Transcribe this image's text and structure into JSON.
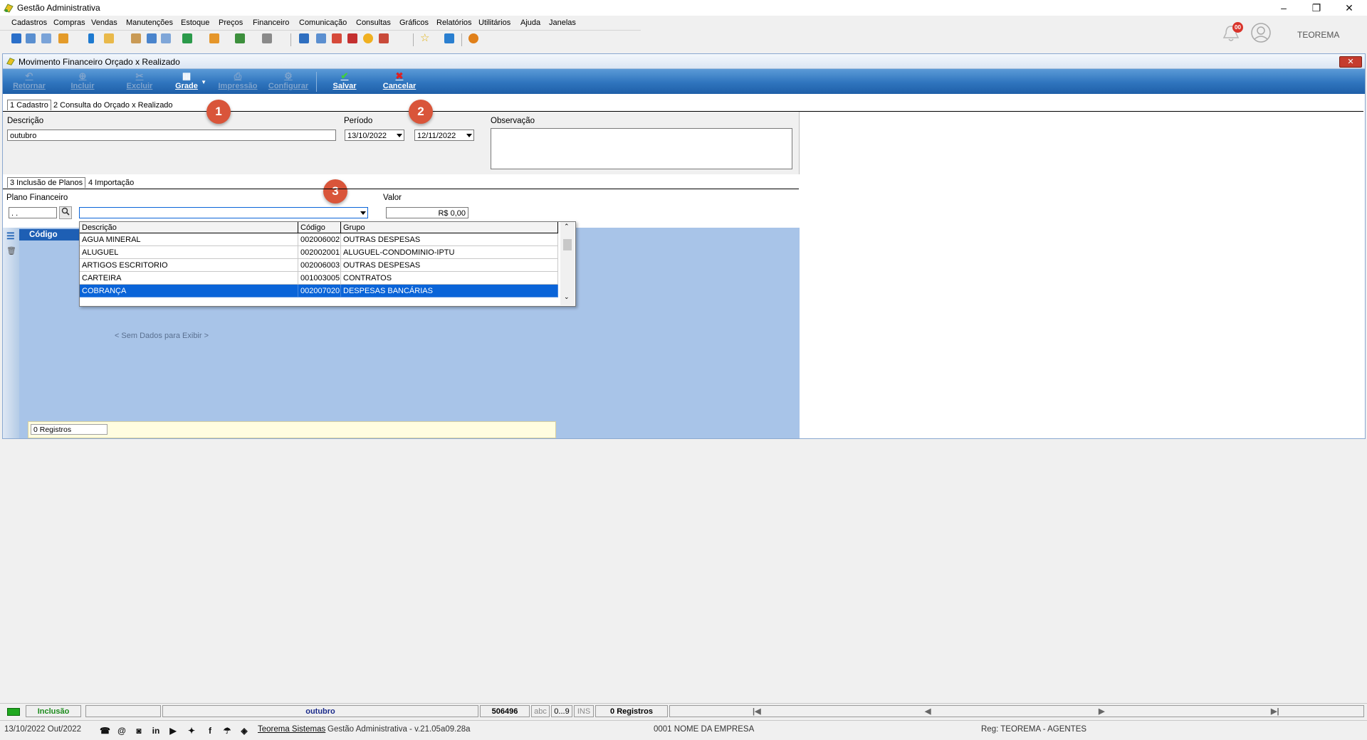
{
  "window": {
    "title": "Gestão Administrativa",
    "controls": {
      "minimize": "–",
      "restore": "❐",
      "close": "✕"
    }
  },
  "menu": [
    "Cadastros",
    "Compras",
    "Vendas",
    "Manutenções",
    "Estoque",
    "Preços",
    "Financeiro",
    "Comunicação",
    "Consultas",
    "Gráficos",
    "Relatórios",
    "Utilitários",
    "Ajuda",
    "Janelas"
  ],
  "header_right": {
    "notifications_count": "00",
    "user_name": "TEOREMA"
  },
  "child_window": {
    "title": "Movimento Financeiro Orçado x Realizado",
    "close_label": "✕"
  },
  "ribbon": {
    "buttons": [
      {
        "label": "Retornar",
        "icon": "↶",
        "enabled": false
      },
      {
        "label": "Incluir",
        "icon": "⊕",
        "enabled": false
      },
      {
        "label": "Excluir",
        "icon": "✂",
        "enabled": false
      },
      {
        "label": "Grade",
        "icon": "▦",
        "enabled": true
      },
      {
        "label": "Impressão",
        "icon": "⎙",
        "enabled": false
      },
      {
        "label": "Configurar",
        "icon": "⚙",
        "enabled": false
      },
      {
        "label": "Salvar",
        "icon": "✔",
        "enabled": true
      },
      {
        "label": "Cancelar",
        "icon": "✖",
        "enabled": true
      }
    ]
  },
  "tabs_main": [
    "1 Cadastro",
    "2 Consulta do Orçado x Realizado"
  ],
  "form": {
    "descricao_label": "Descrição",
    "descricao_value": "outubro",
    "periodo_label": "Período",
    "periodo_inicio": "13/10/2022",
    "periodo_fim": "12/11/2022",
    "observacao_label": "Observação",
    "observacao_value": ""
  },
  "badges": [
    "1",
    "2",
    "3"
  ],
  "tabs_sub": [
    "3 Inclusão de Planos",
    "4 Importação"
  ],
  "plano": {
    "label": "Plano Financeiro",
    "code_value": " .  . ",
    "combo_value": "",
    "valor_label": "Valor",
    "valor_value": "R$ 0,00"
  },
  "dropdown": {
    "headers": [
      "Descrição",
      "Código",
      "Grupo"
    ],
    "rows": [
      {
        "descricao": "AGUA MINERAL",
        "codigo": "002006002",
        "grupo": "OUTRAS DESPESAS"
      },
      {
        "descricao": "ALUGUEL",
        "codigo": "002002001",
        "grupo": "ALUGUEL-CONDOMINIO-IPTU"
      },
      {
        "descricao": "ARTIGOS ESCRITORIO",
        "codigo": "002006003",
        "grupo": "OUTRAS DESPESAS"
      },
      {
        "descricao": "CARTEIRA",
        "codigo": "001003005",
        "grupo": "CONTRATOS"
      },
      {
        "descricao": "COBRANÇA",
        "codigo": "002007020",
        "grupo": "DESPESAS BANCÁRIAS"
      }
    ],
    "selected_index": 4
  },
  "grid": {
    "column_header": "Código",
    "empty_message": "< Sem Dados para Exibir >",
    "records": "0 Registros"
  },
  "statusbar": {
    "mode": "Inclusão",
    "current": "outubro",
    "id": "506496",
    "abc": "abc",
    "num": "0...9",
    "ins": "INS",
    "records": "0 Registros",
    "nav": [
      "|◀",
      "◀",
      "▶",
      "▶|"
    ]
  },
  "footer": {
    "datetime": "13/10/2022 Out/2022",
    "company_link": "Teorema Sistemas",
    "version": "Gestão Administrativa - v.21.05a09.28a",
    "empresa": "0001 NOME DA EMPRESA",
    "registro": "Reg: TEOREMA - AGENTES"
  },
  "colors": {
    "ribbon": "#2f75be",
    "selection": "#0a64d8",
    "badge": "#d9553a",
    "grid_bg": "#a8c4e8"
  }
}
